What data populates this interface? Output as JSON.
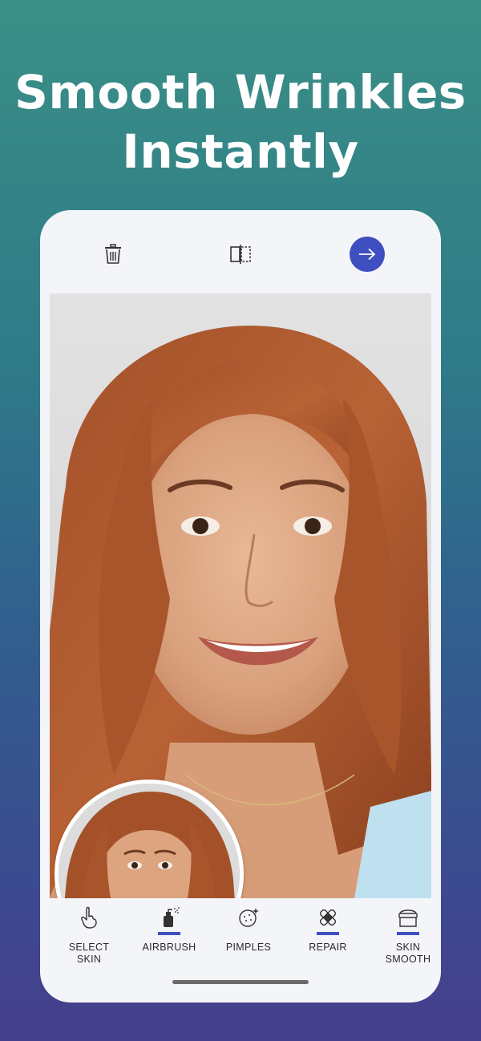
{
  "headline": {
    "line1": "Smooth Wrinkles",
    "line2": "Instantly"
  },
  "toolbar": {
    "trash_icon": "trash-icon",
    "compare_icon": "compare-split-icon",
    "next_icon": "arrow-right-icon",
    "accent_color": "#3f4fc0"
  },
  "photo": {
    "description_icon": "portrait-photo"
  },
  "tools": [
    {
      "label": "SELECT\nSKIN",
      "icon": "hand-pointer-icon",
      "active": false
    },
    {
      "label": "AIRBRUSH",
      "icon": "airbrush-icon",
      "active": true
    },
    {
      "label": "PIMPLES",
      "icon": "pimples-icon",
      "active": false
    },
    {
      "label": "REPAIR",
      "icon": "bandage-icon",
      "active": true
    },
    {
      "label": "SKIN\nSMOOTH",
      "icon": "cream-jar-icon",
      "active": true
    }
  ]
}
